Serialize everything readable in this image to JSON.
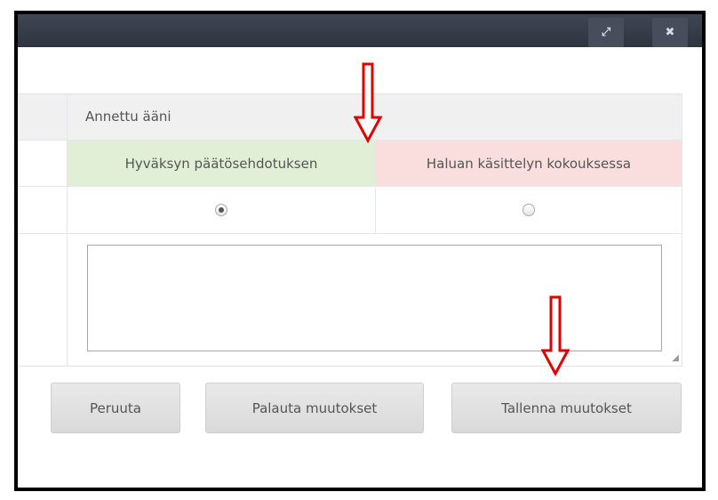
{
  "window": {
    "maximize_icon": "maximize-icon",
    "close_icon": "close-icon"
  },
  "table": {
    "header": "Annettu ääni",
    "options": [
      {
        "label": "Hyväksyn päätösehdotuksen",
        "color": "#e0efd6",
        "selected": true
      },
      {
        "label": "Haluan käsittelyn kokouksessa",
        "color": "#f9dedd",
        "selected": false
      }
    ],
    "comment": {
      "value": "",
      "placeholder": ""
    }
  },
  "buttons": {
    "cancel": "Peruuta",
    "reset": "Palauta muutokset",
    "save": "Tallenna muutokset"
  },
  "annotations": {
    "arrow_color": "#e00000"
  }
}
